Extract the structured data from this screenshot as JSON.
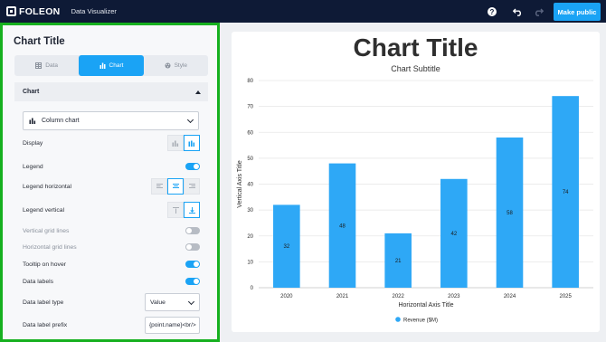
{
  "app": {
    "logo": "FOLEON",
    "name": "Data Visualizer",
    "publish_label": "Make public"
  },
  "panel": {
    "title": "Chart Title",
    "tabs": [
      {
        "label": "Data",
        "icon": "table-icon",
        "active": false
      },
      {
        "label": "Chart",
        "icon": "bar-chart-icon",
        "active": true
      },
      {
        "label": "Style",
        "icon": "palette-icon",
        "active": false
      }
    ],
    "section_label": "Chart",
    "chart_type": "Column chart",
    "rows": {
      "display": "Display",
      "legend": "Legend",
      "legend_horizontal": "Legend horizontal",
      "legend_vertical": "Legend vertical",
      "vertical_grid": "Vertical grid lines",
      "horizontal_grid": "Horizontal grid lines",
      "tooltip": "Tooltip on hover",
      "data_labels": "Data labels",
      "data_label_type": "Data label type",
      "data_label_prefix": "Data label prefix"
    },
    "toggles": {
      "legend": true,
      "vertical_grid": false,
      "horizontal_grid": false,
      "tooltip": true,
      "data_labels": true
    },
    "data_label_type_value": "Value",
    "data_label_prefix_value": "{point.name}<br/>"
  },
  "colors": {
    "accent": "#1aa3f5",
    "topbar": "#0e1a36",
    "panel_border": "#16b01f",
    "bar": "#2ea8f6"
  },
  "chart_data": {
    "type": "bar",
    "title": "Chart Title",
    "subtitle": "Chart Subtitle",
    "xlabel": "Horizontal Axis Title",
    "ylabel": "Vertical Axis Title",
    "categories": [
      "2020",
      "2021",
      "2022",
      "2023",
      "2024",
      "2025"
    ],
    "series": [
      {
        "name": "Revenue ($M)",
        "values": [
          32,
          48,
          21,
          42,
          58,
          74
        ]
      }
    ],
    "ylim": [
      0,
      80
    ],
    "yticks": [
      0,
      10,
      20,
      30,
      40,
      50,
      60,
      70,
      80
    ],
    "grid": true,
    "legend": "bottom-center",
    "data_labels": true
  }
}
